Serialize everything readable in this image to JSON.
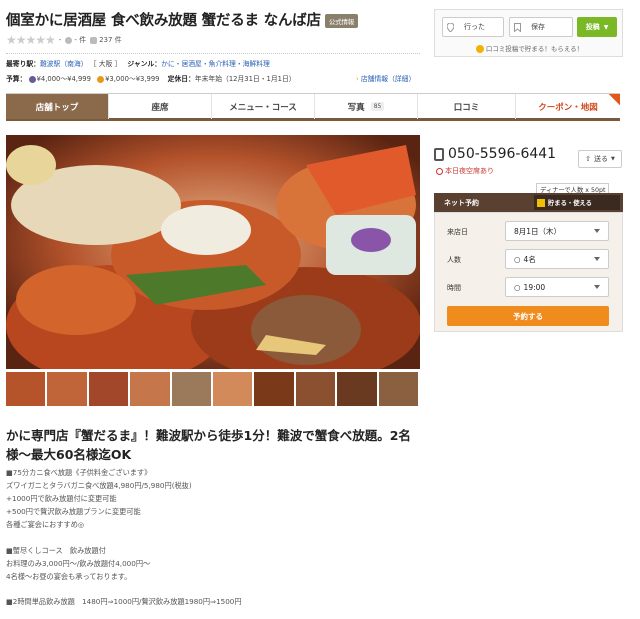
{
  "title": {
    "name": "個室かに居酒屋 食べ飲み放題 蟹だるま なんば店",
    "official_badge": "公式情報"
  },
  "rating": {
    "stars": "★★★★★",
    "score": "-",
    "review_count": "- 件",
    "photo_count": "237 件"
  },
  "info": {
    "station_label": "最寄り駅：",
    "station_value": "難波駅（南海）",
    "area": "［ 大阪 ］",
    "genre_label": "ジャンル：",
    "genre_value": "かに・居酒屋・魚介料理・海鮮料理",
    "budget_label": "予算：",
    "budget_dinner": "¥4,000～¥4,999",
    "budget_lunch": "¥3,000～¥3,999",
    "closed_label": "定休日：",
    "closed_value": "年末年始（12月31日・1月1日）",
    "detail_link": "店舗情報（詳細）"
  },
  "top_right": {
    "went_label": "行った",
    "save_label": "保存",
    "post_label": "投稿",
    "note": "口コミ投稿で貯まる！もらえる！"
  },
  "tabs": [
    {
      "label": "店舗トップ"
    },
    {
      "label": "座席"
    },
    {
      "label": "メニュー・コース"
    },
    {
      "label": "写真",
      "count": "85"
    },
    {
      "label": "口コミ"
    },
    {
      "label": "クーポン・地図"
    }
  ],
  "main": {
    "heading": "かに専門店『蟹だるま』！難波駅から徒歩1分！難波で蟹食べ放題。2名様～最大60名様迄OK",
    "description": [
      "■75分カニ食べ放題《子供料金ございます》",
      "ズワイガニとタラバガニ食べ放題4,980円/5,980円(税抜)",
      "+1000円で飲み放題付に変更可能",
      "+500円で贅沢飲み放題プランに変更可能",
      "各種ご宴会におすすめ◎",
      "",
      "■蟹尽くしコース　飲み放題付",
      "お料理のみ3,000円～/飲み放題付4,000円～",
      "4名様～お昼の宴会も承っております。",
      "",
      "■2時間単品飲み放題　1480円⇒1000円/贅沢飲み放題1980円⇒1500円"
    ]
  },
  "side": {
    "phone": "050-5596-6441",
    "availability": "本日夜空席あり",
    "send_label": "送る",
    "dinner_bubble": "ディナーで人数 x 50pt",
    "reservation_title": "ネット予約",
    "ponta_label": "貯まる・使える",
    "date_label": "来店日",
    "date_value": "8月1日（木）",
    "people_label": "人数",
    "people_value": "4名",
    "time_label": "時間",
    "time_value": "19:00",
    "reserve_button": "予約する"
  },
  "colors": {
    "tab_active": "#8a6a4a",
    "tab_border": "#7a5a3a",
    "post_button": "#7ab826",
    "reserve_button": "#f08c1e",
    "coupon_text": "#d34a1e",
    "reservation_bar": "#5a4030"
  },
  "icons": [
    "pin-icon",
    "bookmark-icon",
    "pencil-icon",
    "phone-icon",
    "share-icon",
    "ponta-icon",
    "comment-icon",
    "camera-icon"
  ]
}
